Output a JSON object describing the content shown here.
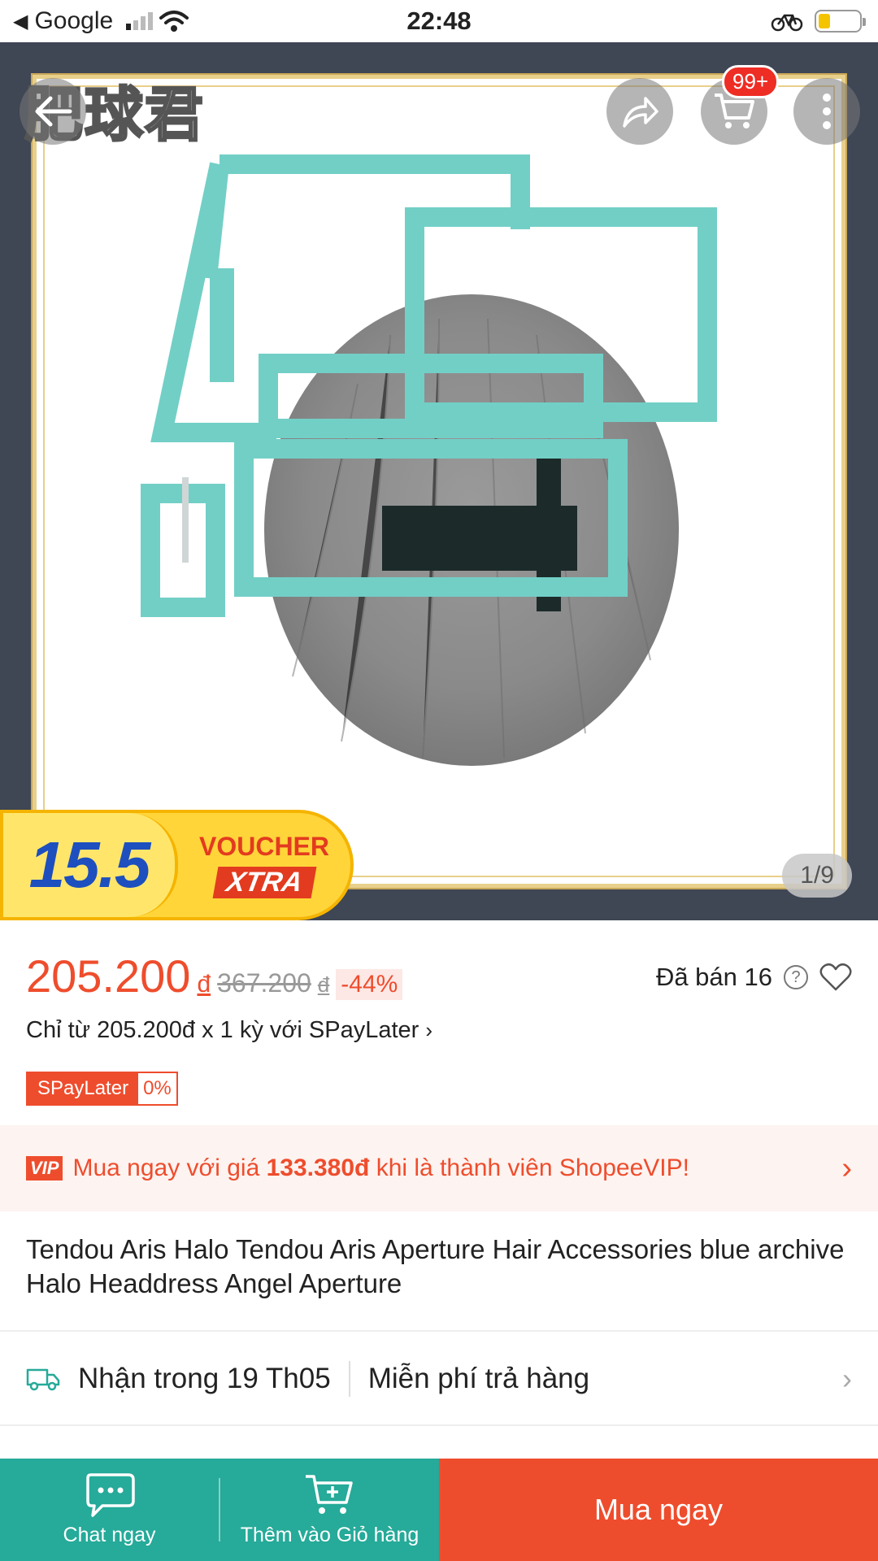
{
  "status_bar": {
    "back_app": "Google",
    "time": "22:48"
  },
  "hero": {
    "watermark": "肥球君",
    "cart_badge": "99+",
    "image_counter": "1/9"
  },
  "voucher": {
    "number": "15.5",
    "label": "VOUCHER",
    "xtra": "XTRA"
  },
  "price": {
    "current": "205.200",
    "currency": "đ",
    "original": "367.200",
    "discount": "-44%",
    "sold": "Đã bán 16",
    "installment": "Chỉ từ 205.200đ x 1 kỳ với SPayLater",
    "spaylater_label": "SPayLater",
    "spaylater_rate": "0%"
  },
  "vip": {
    "badge": "VIP",
    "text_before": "Mua ngay với giá ",
    "price": "133.380đ",
    "text_after": " khi là thành viên ShopeeVIP!"
  },
  "product": {
    "title": "Tendou Aris Halo Tendou Aris Aperture Hair Accessories blue archive Halo Headdress Angel Aperture"
  },
  "shipping": {
    "delivery": "Nhận trong 19 Th05",
    "returns": "Miễn phí trả hàng"
  },
  "bottom_bar": {
    "chat": "Chat ngay",
    "add_cart": "Thêm vào Giỏ hàng",
    "buy_now": "Mua ngay"
  },
  "colors": {
    "brand": "#ee4d2d",
    "green": "#26aa99",
    "halo": "#72cfc6"
  }
}
